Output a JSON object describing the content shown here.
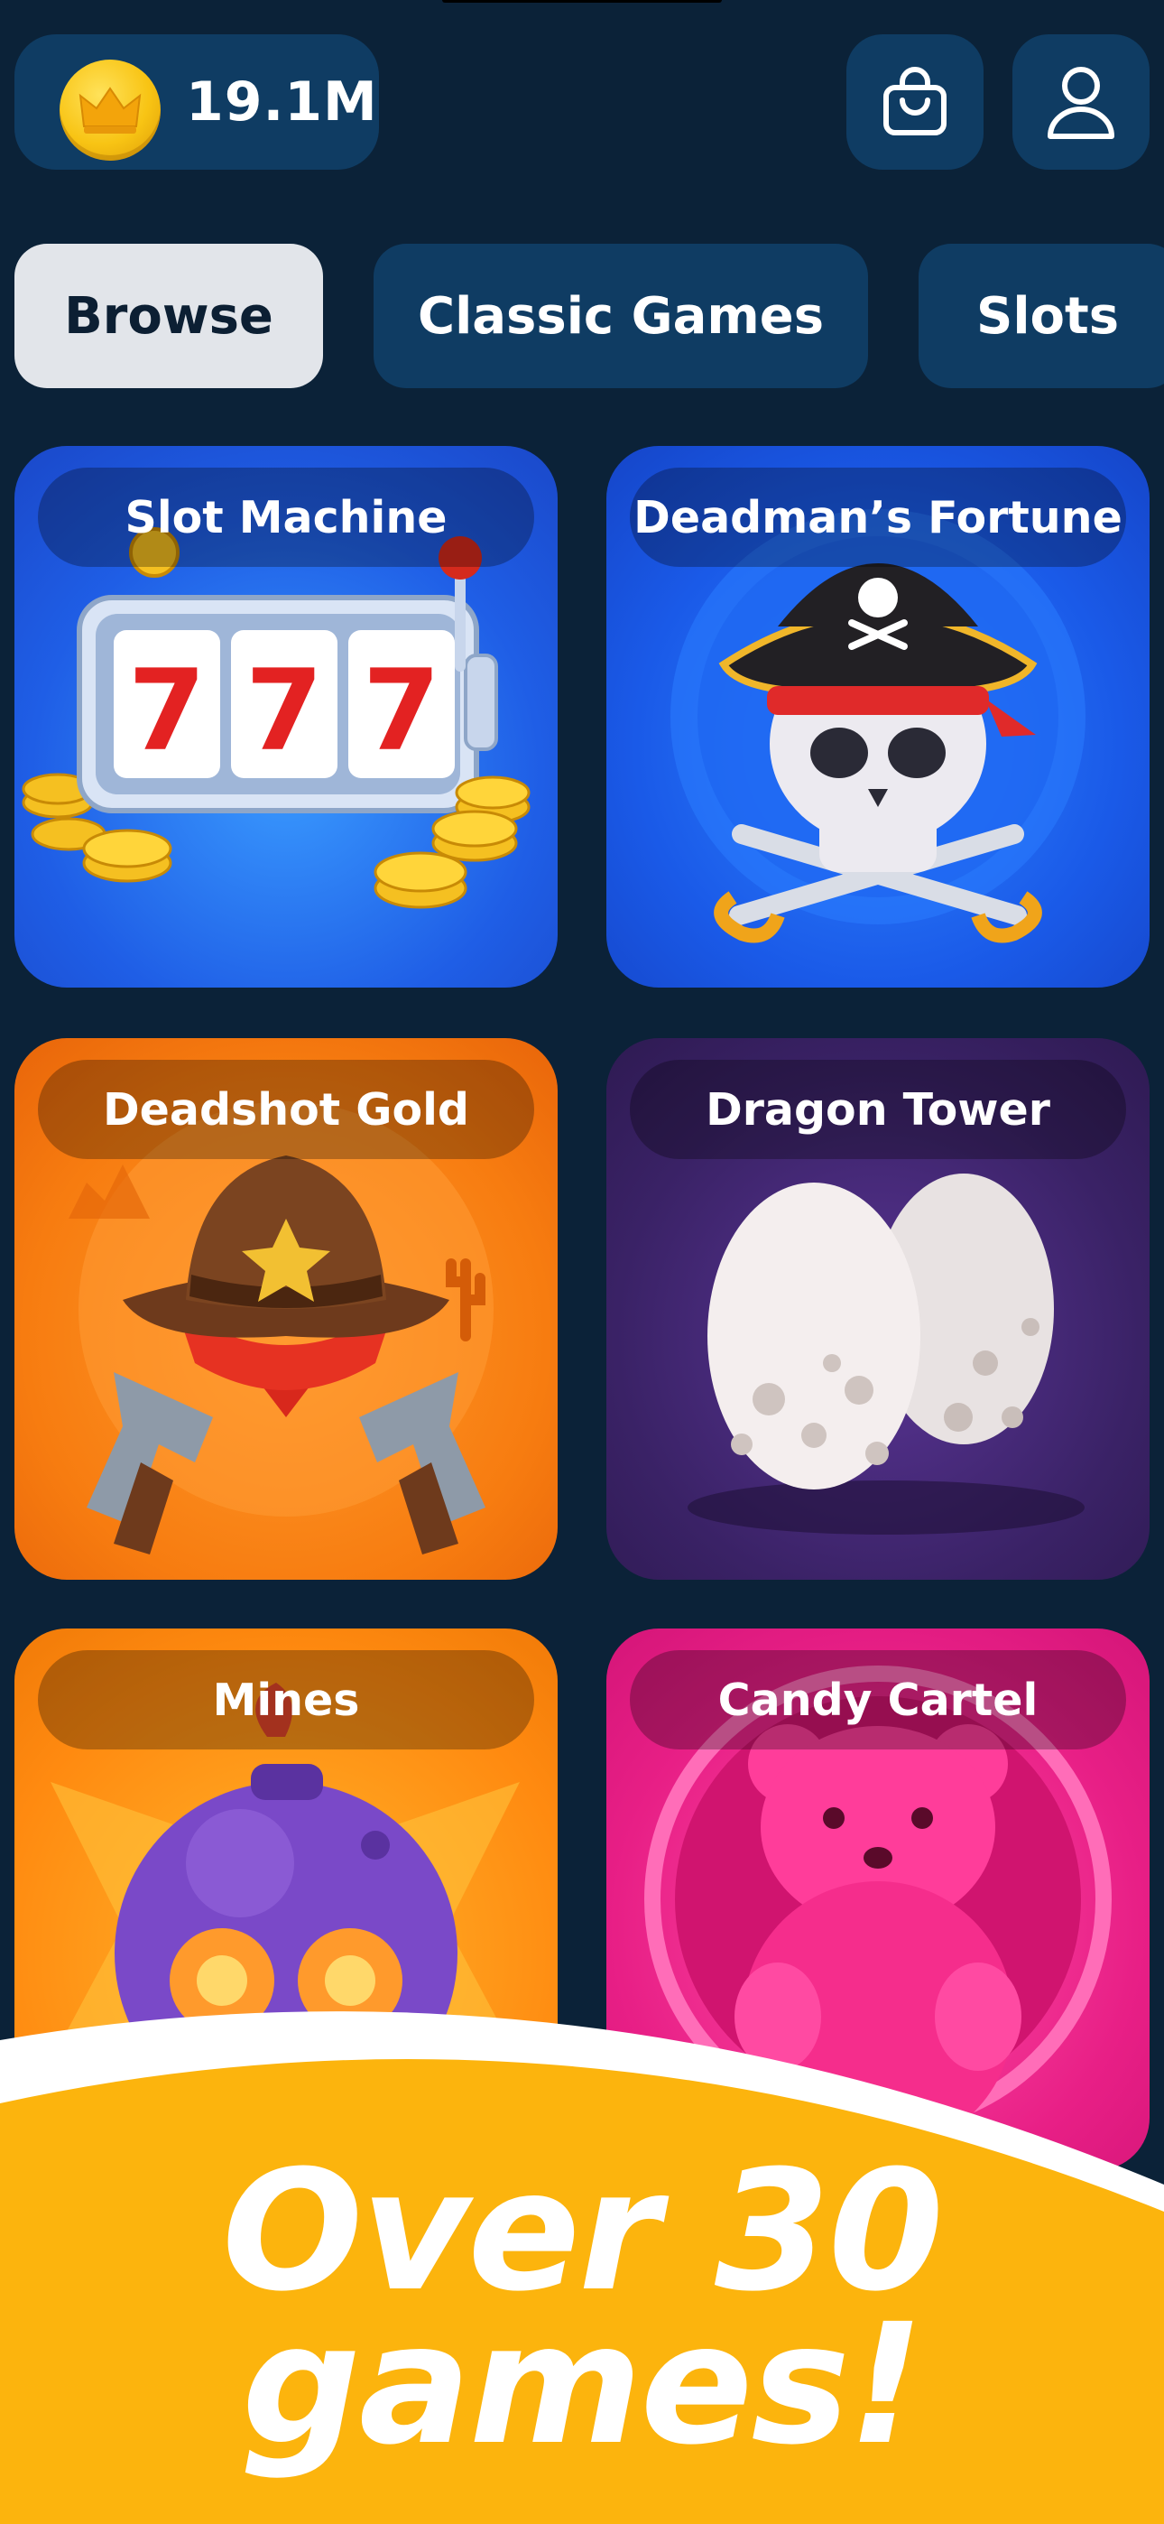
{
  "header": {
    "balance": "19.1M",
    "coin_icon": "crown-coin-icon",
    "shop_icon": "shopping-bag-icon",
    "profile_icon": "user-profile-icon"
  },
  "tabs": [
    {
      "label": "Browse",
      "selected": true
    },
    {
      "label": "Classic Games",
      "selected": false
    },
    {
      "label": "Slots",
      "selected": false
    }
  ],
  "games": [
    {
      "title": "Slot Machine",
      "art": "slot-machine-777-icon",
      "color": "#1f5ee6"
    },
    {
      "title": "Deadman’s Fortune",
      "art": "pirate-skull-icon",
      "color": "#1a5ae8"
    },
    {
      "title": "Deadshot Gold",
      "art": "cowboy-revolvers-icon",
      "color": "#f77c10"
    },
    {
      "title": "Dragon Tower",
      "art": "dragon-eggs-icon",
      "color": "#3a2266"
    },
    {
      "title": "Mines",
      "art": "skull-bomb-icon",
      "color": "#ff8a10"
    },
    {
      "title": "Candy Cartel",
      "art": "gummy-bear-icon",
      "color": "#e81f86"
    }
  ],
  "promo": {
    "line1": "Over 30",
    "line2": "games!",
    "color": "#fcb40d"
  }
}
